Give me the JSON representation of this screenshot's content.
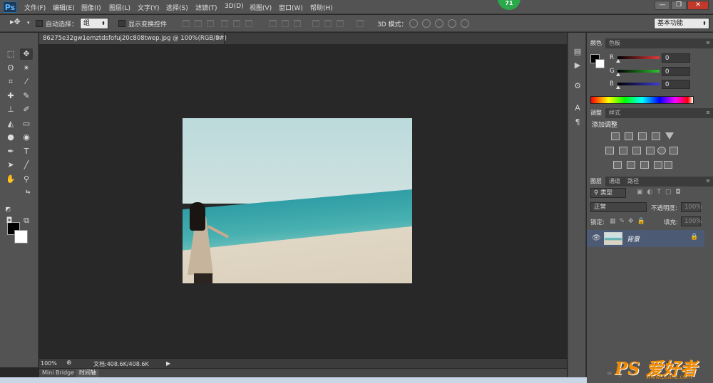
{
  "app": {
    "logo": "Ps",
    "badge": "71"
  },
  "menu": [
    "文件(F)",
    "编辑(E)",
    "图像(I)",
    "图层(L)",
    "文字(Y)",
    "选择(S)",
    "滤镜(T)",
    "3D(D)",
    "视图(V)",
    "窗口(W)",
    "帮助(H)"
  ],
  "window_controls": {
    "minimize": "—",
    "maximize": "❐",
    "close": "✕"
  },
  "options": {
    "auto_select_label": "自动选择：",
    "auto_select_value": "组",
    "show_transform_label": "显示变换控件",
    "mode_3d_label": "3D 模式：",
    "workspace_value": "基本功能"
  },
  "document": {
    "tab_title": "86275e32gw1emztdsfofuj20c808twep.jpg @ 100%(RGB/8#)",
    "close": "×"
  },
  "status": {
    "zoom": "100%",
    "doc_size": "文档:408.6K/408.6K",
    "arrow": "▶"
  },
  "bottom_tabs": [
    "Mini Bridge",
    "时间轴"
  ],
  "color_panel": {
    "tabs": [
      "颜色",
      "色板"
    ],
    "channels": [
      {
        "label": "R",
        "value": "0",
        "color": "#e23a3a"
      },
      {
        "label": "G",
        "value": "0",
        "color": "#2ec42e"
      },
      {
        "label": "B",
        "value": "0",
        "color": "#3b3bd8"
      }
    ]
  },
  "adjust_panel": {
    "tabs": [
      "调整",
      "样式"
    ],
    "title": "添加调整"
  },
  "layers_panel": {
    "tabs": [
      "图层",
      "通道",
      "路径"
    ],
    "filter_kind": "类型",
    "blend_mode": "正常",
    "opacity_label": "不透明度:",
    "opacity_value": "100%",
    "lock_label": "锁定:",
    "fill_label": "填充:",
    "fill_value": "100%",
    "layers": [
      {
        "name": "背景",
        "visible": true,
        "locked": true
      }
    ]
  },
  "watermark": {
    "main": "PS 爱好者",
    "site": "www.psahz.com"
  },
  "colors": {
    "foreground": "#000000",
    "background": "#ffffff",
    "layer_selected": "#4c5a74"
  }
}
